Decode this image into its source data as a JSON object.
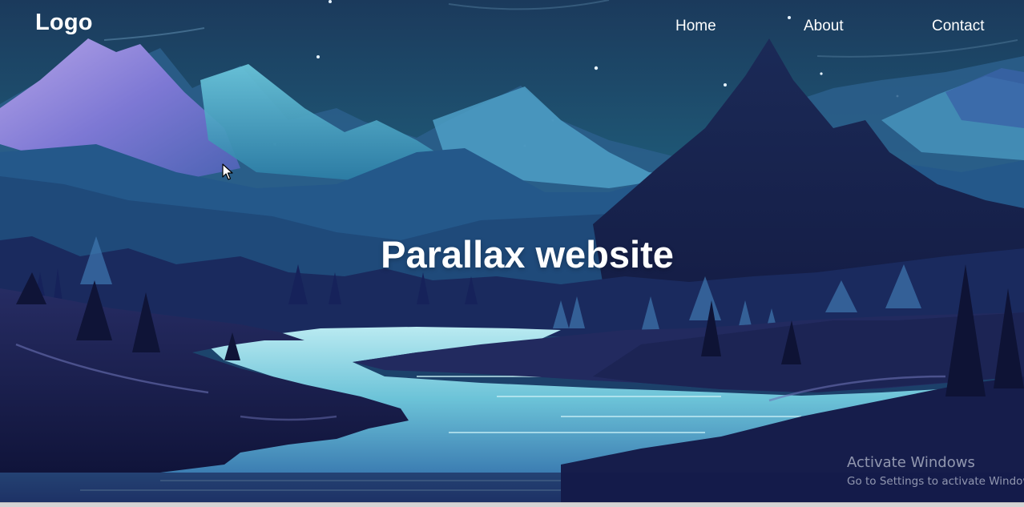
{
  "navbar": {
    "logo": "Logo",
    "links": [
      {
        "label": "Home"
      },
      {
        "label": "About"
      },
      {
        "label": "Contact"
      }
    ]
  },
  "hero": {
    "title": "Parallax website"
  },
  "windows_watermark": {
    "title": "Activate Windows",
    "subtitle": "Go to Settings to activate Windows."
  },
  "colors": {
    "sky_top": "#16405a",
    "sky_mid": "#1e5b77",
    "river": "#6fc7da",
    "foreground": "#141a3e",
    "text": "#ffffff"
  },
  "icons": {
    "cursor": "mouse-pointer-icon"
  }
}
